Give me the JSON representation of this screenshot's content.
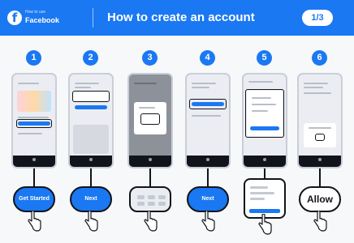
{
  "header": {
    "logo_small": "How to use",
    "logo_brand": "Facebook",
    "title": "How to create an account",
    "step_counter": "1/3"
  },
  "steps": [
    {
      "number": "1",
      "action_label": "Get Started"
    },
    {
      "number": "2",
      "action_label": "Next"
    },
    {
      "number": "3",
      "action_label": ""
    },
    {
      "number": "4",
      "action_label": "Next"
    },
    {
      "number": "5",
      "action_label": ""
    },
    {
      "number": "6",
      "action_label": "Allow"
    }
  ],
  "colors": {
    "brand_blue": "#1a78f2",
    "dark": "#11141a",
    "background": "#f7f8fa"
  },
  "icons": [
    "facebook-logo-icon",
    "tap-hand-icon"
  ]
}
